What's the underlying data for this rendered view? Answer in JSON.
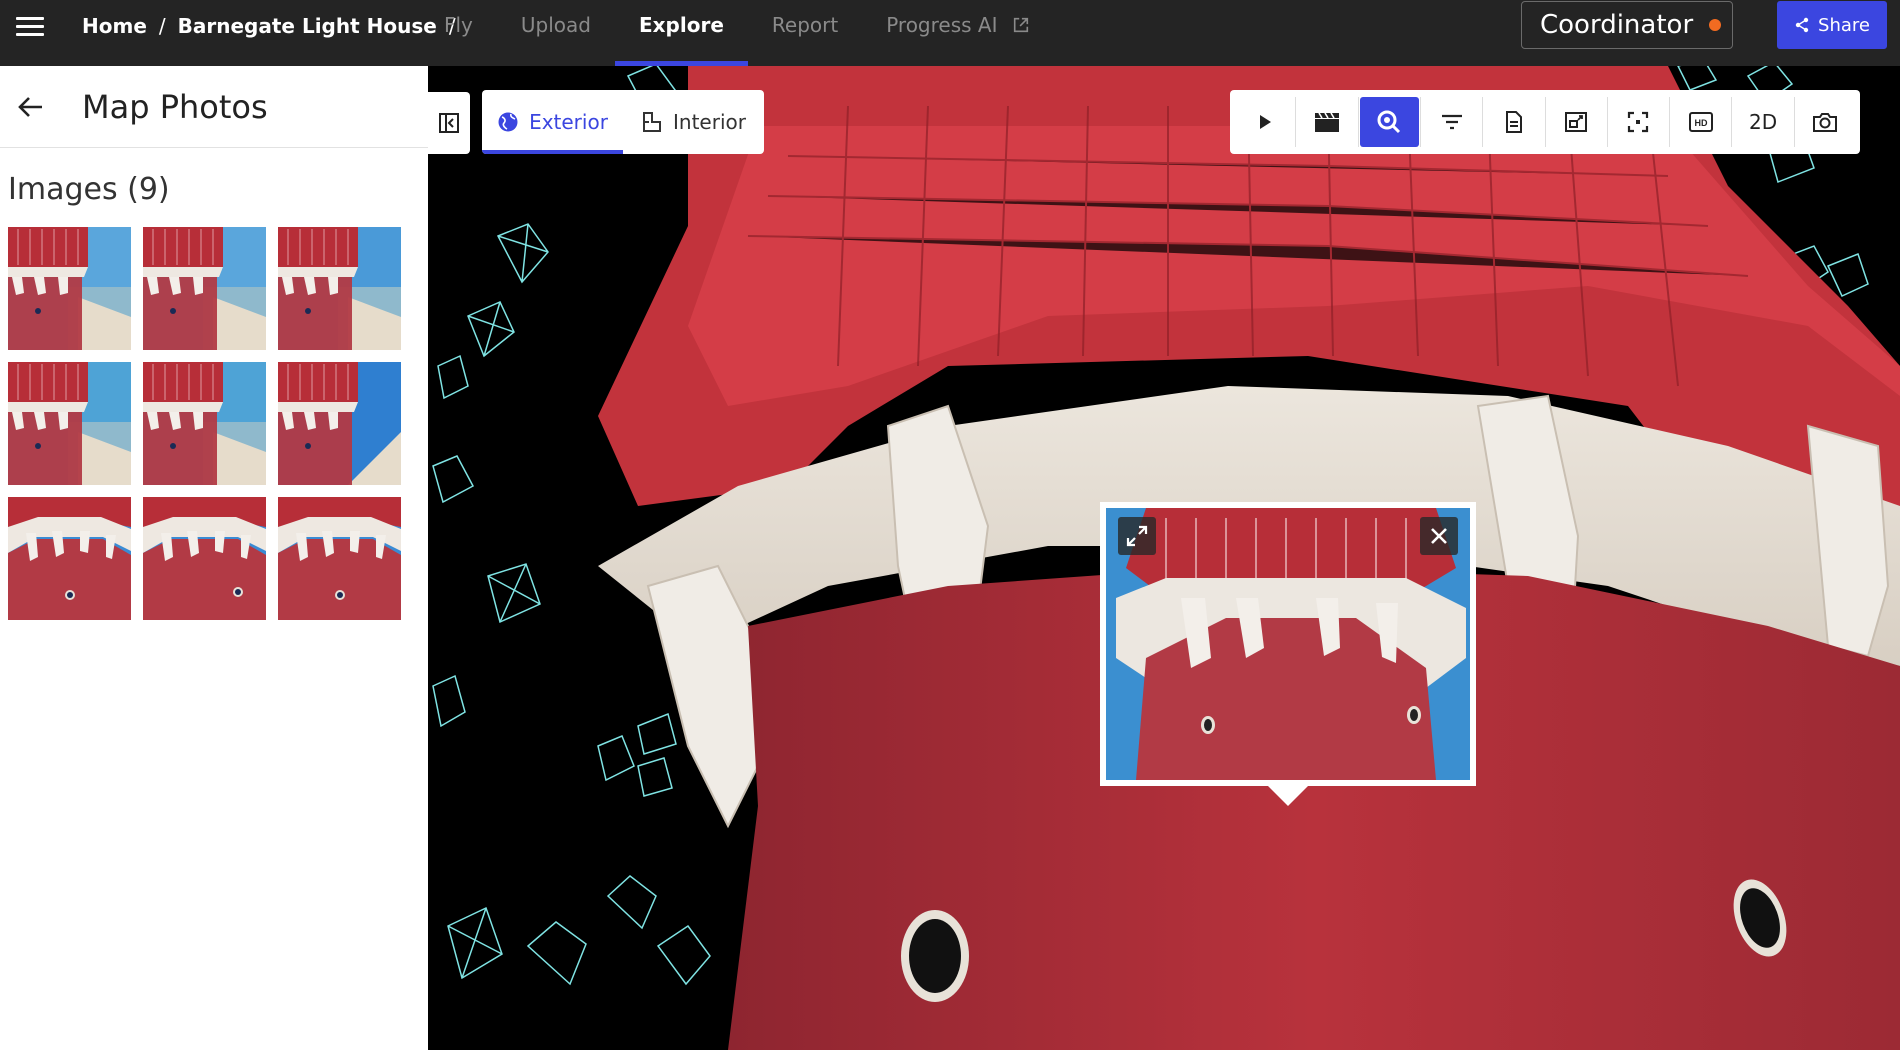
{
  "header": {
    "breadcrumb": [
      {
        "label": "Home"
      },
      {
        "label": "Barnegate Light House"
      }
    ],
    "separator": "/",
    "tabs": [
      {
        "label": "Fly",
        "active": false
      },
      {
        "label": "Upload",
        "active": false
      },
      {
        "label": "Explore",
        "active": true
      },
      {
        "label": "Report",
        "active": false
      },
      {
        "label": "Progress AI",
        "active": false,
        "icon": "external-link-icon"
      }
    ],
    "role": {
      "label": "Coordinator",
      "status_color": "#f26b21"
    },
    "share": {
      "label": "Share",
      "icon": "share-icon"
    }
  },
  "panel": {
    "title": "Map Photos",
    "images_heading": "Images (9)",
    "thumbnails": [
      {
        "index": 1
      },
      {
        "index": 2
      },
      {
        "index": 3
      },
      {
        "index": 4
      },
      {
        "index": 5
      },
      {
        "index": 6
      },
      {
        "index": 7
      },
      {
        "index": 8
      },
      {
        "index": 9
      }
    ]
  },
  "view_toggle": [
    {
      "label": "Exterior",
      "icon": "globe-icon",
      "active": true
    },
    {
      "label": "Interior",
      "icon": "floorplan-icon",
      "active": false
    }
  ],
  "toolbar": {
    "tools": [
      {
        "name": "play-button",
        "icon": "play-icon"
      },
      {
        "name": "clapperboard-button",
        "icon": "clapperboard-icon"
      },
      {
        "name": "zoom-button",
        "icon": "zoom-icon",
        "active": true
      },
      {
        "name": "filter-button",
        "icon": "filter-icon"
      },
      {
        "name": "document-button",
        "icon": "document-icon"
      },
      {
        "name": "resize-button",
        "icon": "resize-icon"
      },
      {
        "name": "focus-button",
        "icon": "focus-icon"
      },
      {
        "name": "hd-button",
        "icon": "hd-icon"
      },
      {
        "name": "2d-button",
        "label": "2D"
      },
      {
        "name": "camera-button",
        "icon": "camera-icon"
      }
    ]
  },
  "colors": {
    "accent": "#3b46e0",
    "topbar_bg": "#242424",
    "camera_frustum": "#7fe3e3",
    "lighthouse_red": "#b8323c"
  }
}
